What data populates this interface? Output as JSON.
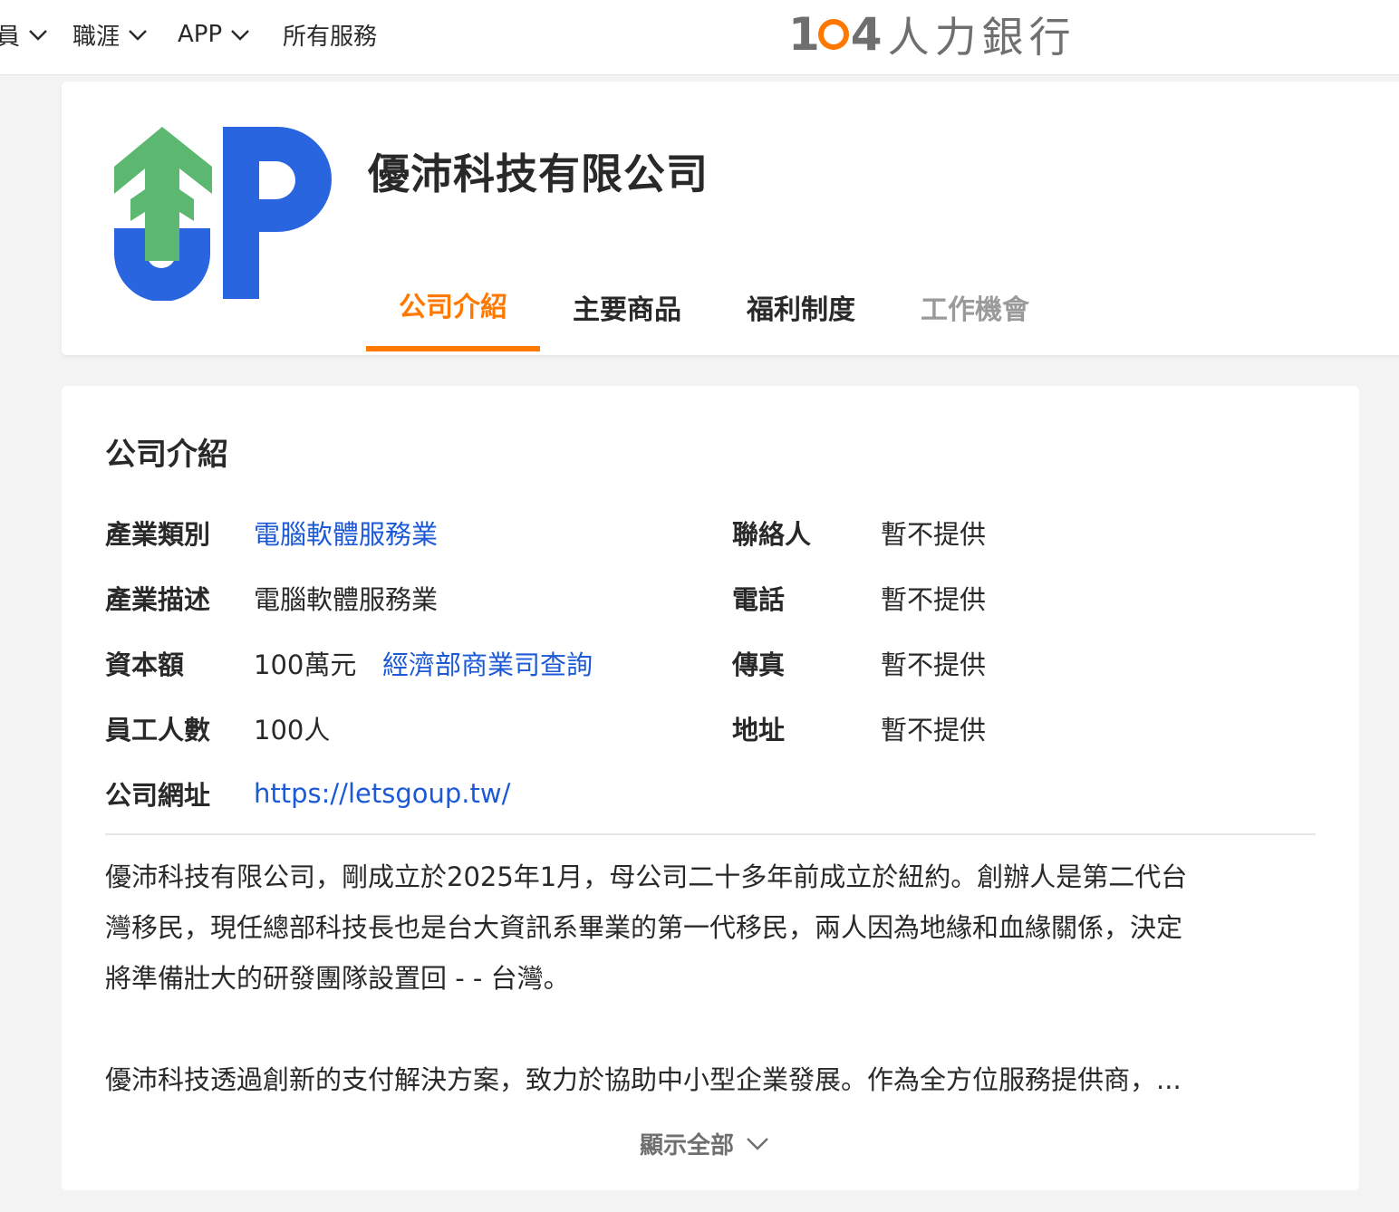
{
  "nav": {
    "items": [
      {
        "label": "員",
        "has_dropdown": true
      },
      {
        "label": "職涯",
        "has_dropdown": true
      },
      {
        "label": "APP",
        "has_dropdown": true
      },
      {
        "label": "所有服務",
        "has_dropdown": false
      }
    ],
    "brand": {
      "number": "104",
      "text": "人力銀行",
      "accent": "#ff7800"
    }
  },
  "company": {
    "name": "優沛科技有限公司",
    "logo_colors": {
      "arrow": "#5cb870",
      "letter": "#2a65e0"
    }
  },
  "tabs": [
    {
      "label": "公司介紹",
      "active": true
    },
    {
      "label": "主要商品",
      "active": false
    },
    {
      "label": "福利制度",
      "active": false
    },
    {
      "label": "工作機會",
      "active": false
    }
  ],
  "intro": {
    "title": "公司介紹",
    "industry_label": "產業類別",
    "industry_value": "電腦軟體服務業",
    "industry_desc_label": "產業描述",
    "industry_desc_value": "電腦軟體服務業",
    "capital_label": "資本額",
    "capital_value": "100萬元",
    "capital_link": "經濟部商業司查詢",
    "employees_label": "員工人數",
    "employees_value": "100人",
    "website_label": "公司網址",
    "website_value": "https://letsgoup.tw/",
    "contact_label": "聯絡人",
    "contact_value": "暫不提供",
    "phone_label": "電話",
    "phone_value": "暫不提供",
    "fax_label": "傳真",
    "fax_value": "暫不提供",
    "address_label": "地址",
    "address_value": "暫不提供",
    "paragraph1_line1": "優沛科技有限公司，剛成立於2025年1月，母公司二十多年前成立於紐約。創辦人是第二代台",
    "paragraph1_line2": "灣移民，現任總部科技長也是台大資訊系畢業的第一代移民，兩人因為地緣和血緣關係，決定",
    "paragraph1_line3": "將準備壯大的研發團隊設置回 - - 台灣。",
    "paragraph2": "優沛科技透過創新的支付解決方案，致力於協助中小型企業發展。作為全方位服務提供商，...",
    "show_all": "顯示全部"
  },
  "colors": {
    "link": "#1c59d6",
    "accent": "#ff7800",
    "text": "#292929",
    "muted": "#9a9a9a"
  }
}
